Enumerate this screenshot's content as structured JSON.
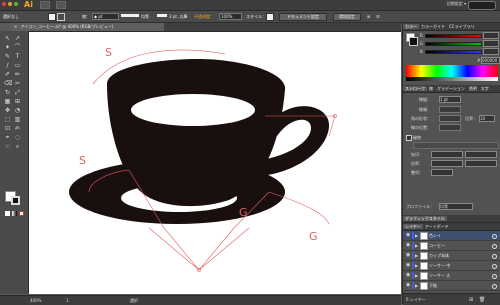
{
  "app": {
    "logo": "Ai",
    "workspace": "初期設定 ▾"
  },
  "control_bar": {
    "selection": "選択なし",
    "stroke_label": "線：",
    "stroke_weight": "◆ pt",
    "uniform": "均等",
    "brush": "3 pt. 丸筆",
    "opacity_label": "不透明度：",
    "opacity": "100%",
    "style_label": "スタイル：",
    "doc_setup": "ドキュメント設定",
    "prefs": "環境設定"
  },
  "document_tab": "アイコン_コーヒー.ai* @ 400% (RGB/プレビュー)",
  "toolbox": {
    "tools": [
      "↖",
      "↗",
      "✦",
      "⌒",
      "✎",
      "T",
      "/",
      "▭",
      "✐",
      "✏",
      "⌫",
      "✂",
      "↻",
      "⤢",
      "▦",
      "⊞",
      "✥",
      "◔",
      "⬚",
      "▥",
      "⊡",
      "✍",
      "⌖",
      "◌",
      "☜",
      "⌕"
    ]
  },
  "canvas": {
    "guide_labels": [
      "S",
      "S",
      "G",
      "G"
    ]
  },
  "status_bar": {
    "zoom": "400%",
    "page": "1",
    "mode": "選択"
  },
  "color_panel": {
    "tabs": [
      "カラー",
      "カラーガイド",
      "CCライブラリ"
    ],
    "channels": [
      {
        "label": "R",
        "value": "",
        "color": "#e05050"
      },
      {
        "label": "G",
        "value": "",
        "color": "#50c050"
      },
      {
        "label": "B",
        "value": "",
        "color": "#5070e0"
      }
    ],
    "hex": "000000"
  },
  "stroke_panel": {
    "tabs": [
      "ストローク",
      "線",
      "グラデーション",
      "透明",
      "文字",
      "段落",
      "Open"
    ],
    "weight_label": "線幅：",
    "weight_value": "1 pt",
    "cap_label": "線端：",
    "corner_label": "角の形状：",
    "limit_label": "比率：",
    "limit_value": "10",
    "align_label": "線の位置：",
    "dash_label": "破線",
    "arrow_label": "矢印：",
    "scale_label": "倍率：",
    "align2_label": "整列：",
    "profile_label": "プロファイル：",
    "profile_value": "均等"
  },
  "graphic_styles": {
    "title": "グラフィックスタイル"
  },
  "layers_panel": {
    "tabs": [
      "レイヤー",
      "アートボード"
    ],
    "layers": [
      {
        "name": "色レイ",
        "color": "#4a5bdc",
        "selected": true
      },
      {
        "name": "コーヒー",
        "color": "#4a5bdc",
        "selected": false
      },
      {
        "name": "カップ本体",
        "color": "#4a5bdc",
        "selected": false
      },
      {
        "name": "ソーサー 中",
        "color": "#4a5bdc",
        "selected": false
      },
      {
        "name": "ソーサー 大",
        "color": "#4a5bdc",
        "selected": false
      },
      {
        "name": "下絵",
        "color": "#4a5bdc",
        "selected": false
      }
    ],
    "footer": "6 レイヤー"
  }
}
